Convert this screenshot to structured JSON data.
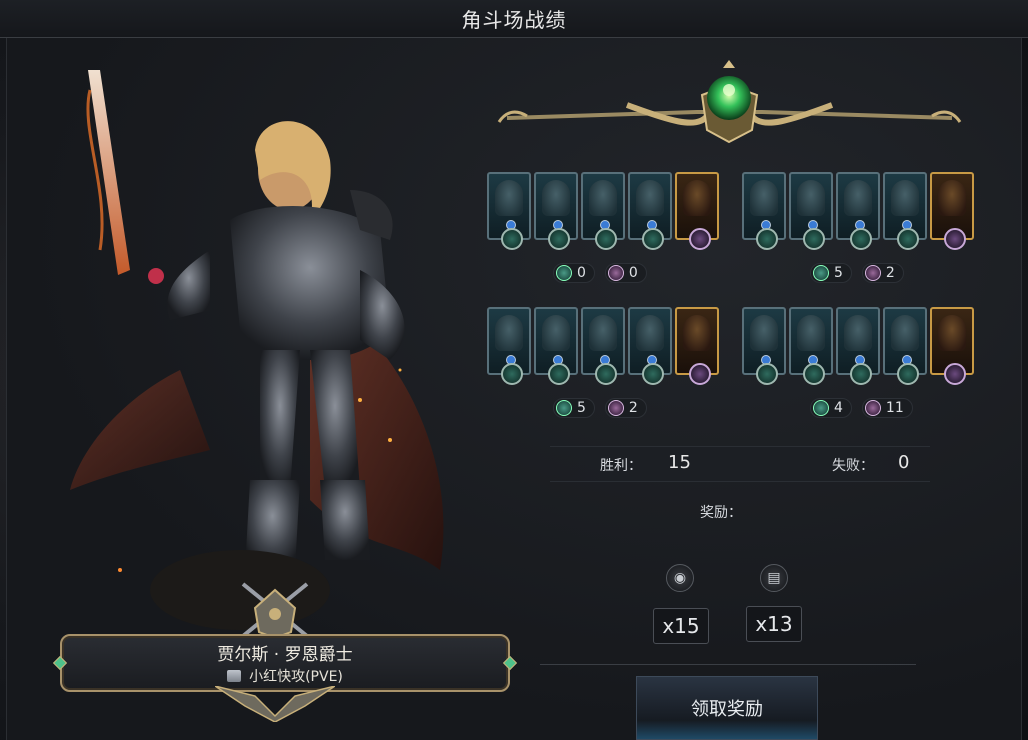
{
  "window": {
    "title": "角斗场战绩"
  },
  "hero": {
    "name": "贾尔斯 · 罗恩爵士",
    "mode": "小红快攻(PVE)"
  },
  "teams": [
    {
      "wins": "0",
      "losses": "0",
      "cards": [
        "teal",
        "teal",
        "teal",
        "teal",
        "gold"
      ]
    },
    {
      "wins": "5",
      "losses": "2",
      "cards": [
        "teal",
        "teal",
        "teal",
        "teal",
        "gold"
      ]
    },
    {
      "wins": "5",
      "losses": "2",
      "cards": [
        "teal",
        "teal",
        "teal",
        "teal",
        "gold"
      ]
    },
    {
      "wins": "4",
      "losses": "11",
      "cards": [
        "teal",
        "teal",
        "teal",
        "teal",
        "gold"
      ]
    }
  ],
  "stats": {
    "wins_label": "胜利：",
    "wins_value": "15",
    "losses_label": "失败：",
    "losses_value": "0"
  },
  "rewards": {
    "label": "奖励：",
    "items": [
      {
        "icon": "gold-bag-icon",
        "amount": "x15"
      },
      {
        "icon": "card-pack-icon",
        "amount": "x13"
      }
    ],
    "claim_label": "领取奖励"
  },
  "colors": {
    "accent_gold": "#c89a45",
    "accent_teal": "#2f6b5e",
    "gem_green": "#4ec28a"
  }
}
